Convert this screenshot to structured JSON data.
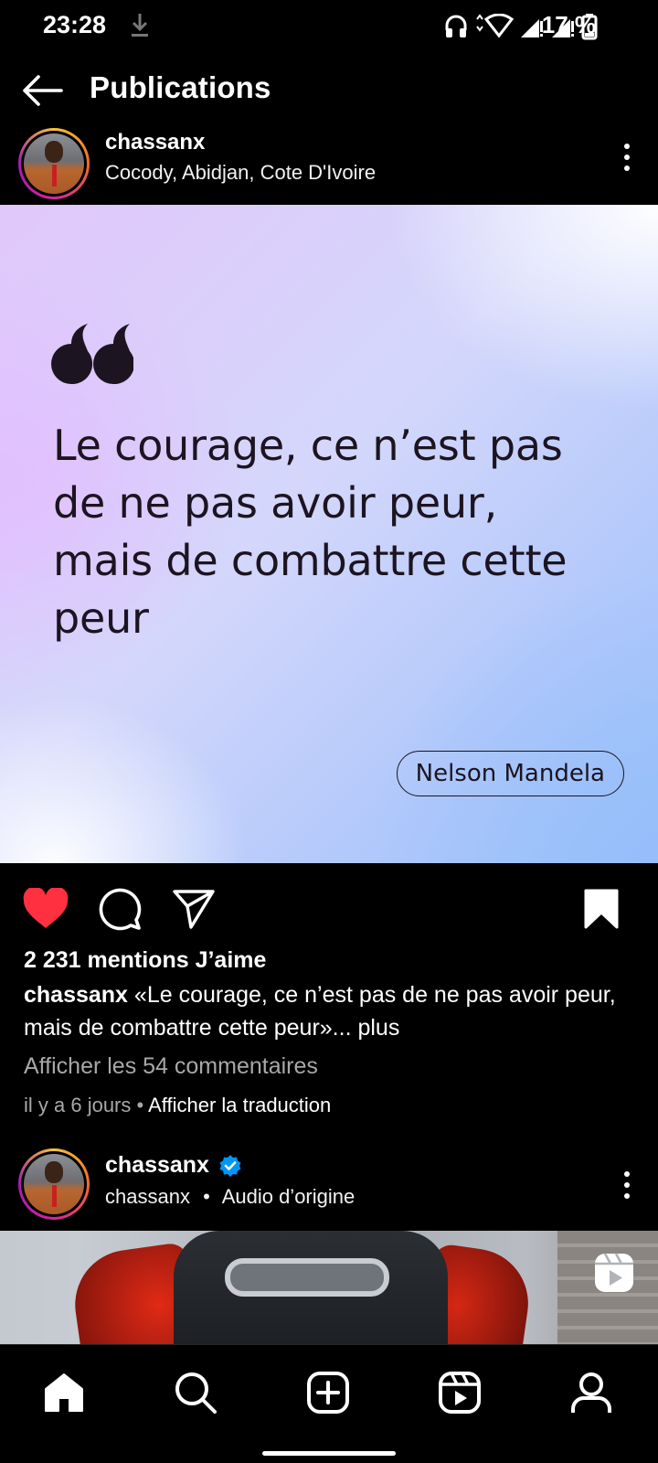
{
  "status_bar": {
    "time": "23:28",
    "battery_text": "17 %",
    "icons": [
      "download-icon",
      "headphones-icon",
      "wifi-icon",
      "signal-icon",
      "signal-icon",
      "battery-icon"
    ]
  },
  "header": {
    "title": "Publications",
    "back_icon": "arrow-left-icon"
  },
  "post": {
    "username": "chassanx",
    "location": "Cocody, Abidjan, Cote D'Ivoire",
    "quote": "Le courage, ce n’est pas de ne pas avoir peur, mais de combattre cette peur",
    "author": "Nelson Mandela",
    "liked": true,
    "saved": true,
    "likes": "2 231 mentions J’aime",
    "caption_user": "chassanx",
    "caption_text": " «Le courage, ce n’est pas de ne pas avoir peur, mais de combattre cette peur»...",
    "caption_more": " plus",
    "comments_link": "Afficher les 54 commentaires",
    "time_ago": "il y a 6 jours",
    "separator": " • ",
    "translate": "Afficher la traduction"
  },
  "post2": {
    "username": "chassanx",
    "verified": true,
    "sub_user": "chassanx",
    "bullet": "•",
    "audio": "Audio d’origine",
    "badge_icon": "reels-icon"
  },
  "nav": {
    "items": [
      "home-icon",
      "search-icon",
      "create-icon",
      "reels-icon",
      "profile-icon"
    ]
  },
  "colors": {
    "like": "#ff3040",
    "verified": "#0095f6",
    "muted_text": "#a8a8a8",
    "quote_text": "#1c1420"
  }
}
